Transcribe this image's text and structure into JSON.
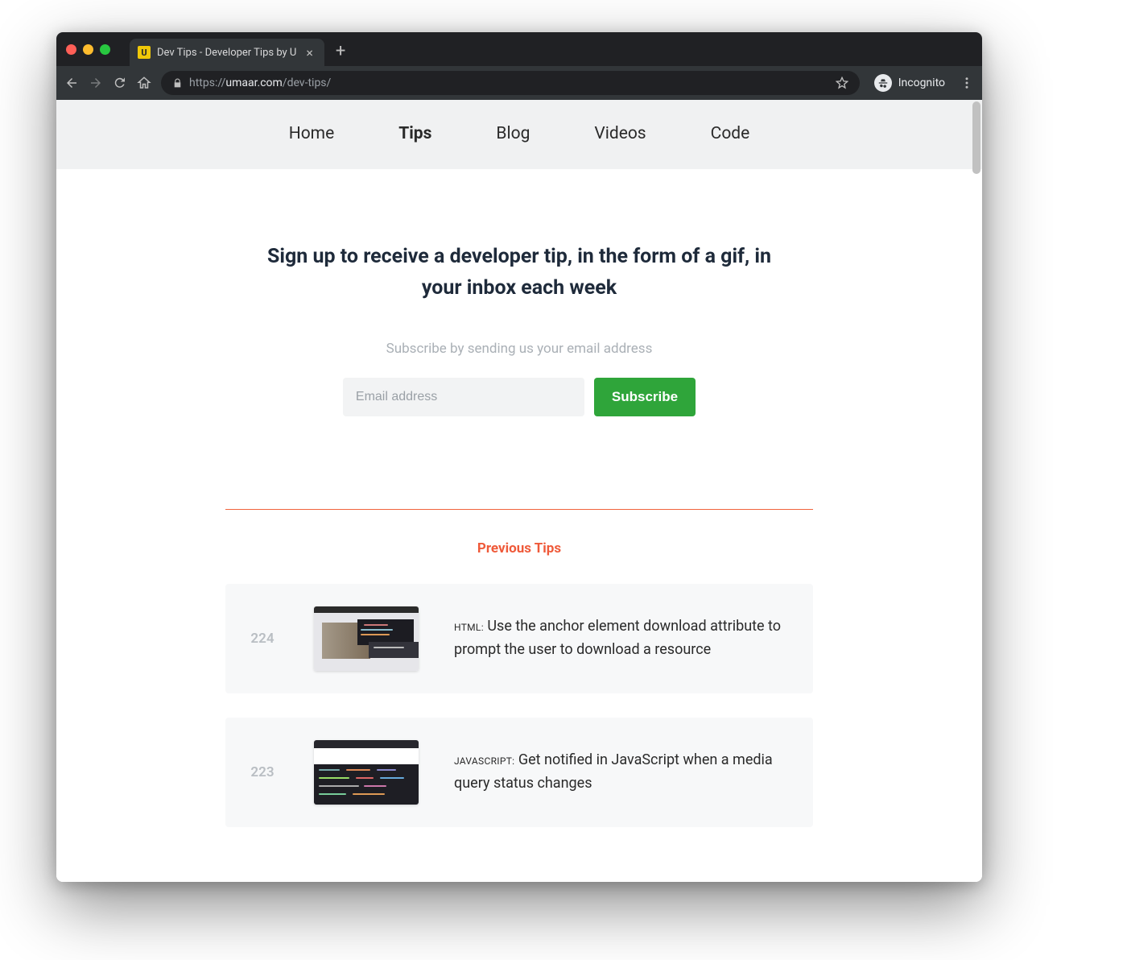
{
  "browser": {
    "tab_title": "Dev Tips - Developer Tips by U",
    "favicon_letter": "U",
    "url_proto": "https://",
    "url_domain": "umaar.com",
    "url_path": "/dev-tips/",
    "incognito_label": "Incognito"
  },
  "nav": {
    "items": [
      "Home",
      "Tips",
      "Blog",
      "Videos",
      "Code"
    ],
    "active_index": 1
  },
  "hero": {
    "title": "Sign up to receive a developer tip, in the form of a gif, in your inbox each week",
    "blurb": "Subscribe by sending us your email address",
    "email_placeholder": "Email address",
    "subscribe_label": "Subscribe"
  },
  "prev_heading": "Previous Tips",
  "tips": [
    {
      "num": "224",
      "tag": "HTML:",
      "title": "Use the anchor element download attribute to prompt the user to download a resource"
    },
    {
      "num": "223",
      "tag": "JavaScript:",
      "title": "Get notified in JavaScript when a media query status changes"
    }
  ]
}
